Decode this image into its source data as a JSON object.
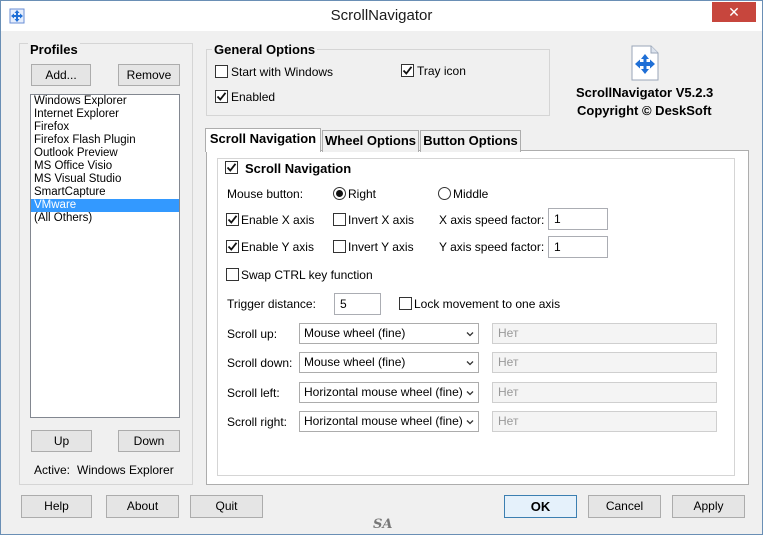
{
  "window": {
    "title": "ScrollNavigator",
    "close_glyph": "✕"
  },
  "profiles": {
    "heading": "Profiles",
    "add_label": "Add...",
    "remove_label": "Remove",
    "items": [
      "Windows Explorer",
      "Internet Explorer",
      "Firefox",
      "Firefox Flash Plugin",
      "Outlook Preview",
      "MS Office Visio",
      "MS Visual Studio",
      "SmartCapture",
      "VMware",
      "(All Others)"
    ],
    "selected_index": 8,
    "up_label": "Up",
    "down_label": "Down",
    "active_label": "Active:",
    "active_value": "Windows Explorer"
  },
  "general": {
    "heading": "General Options",
    "start_with_windows": {
      "label": "Start with Windows",
      "checked": false
    },
    "tray_icon": {
      "label": "Tray icon",
      "checked": true
    },
    "enabled": {
      "label": "Enabled",
      "checked": true
    }
  },
  "about": {
    "version": "ScrollNavigator V5.2.3",
    "copyright": "Copyright © DeskSoft"
  },
  "tabs": [
    "Scroll Navigation",
    "Wheel Options",
    "Button Options"
  ],
  "active_tab": 0,
  "scroll_nav": {
    "group_label": "Scroll Navigation",
    "group_checked": true,
    "mouse_button_label": "Mouse button:",
    "right_label": "Right",
    "middle_label": "Middle",
    "mouse_button_selected": "Right",
    "enable_x": {
      "label": "Enable X axis",
      "checked": true
    },
    "invert_x": {
      "label": "Invert X axis",
      "checked": false
    },
    "x_speed_label": "X axis speed factor:",
    "x_speed_value": "1",
    "enable_y": {
      "label": "Enable Y axis",
      "checked": true
    },
    "invert_y": {
      "label": "Invert Y axis",
      "checked": false
    },
    "y_speed_label": "Y axis speed factor:",
    "y_speed_value": "1",
    "swap_ctrl": {
      "label": "Swap CTRL key function",
      "checked": false
    },
    "trigger_label": "Trigger distance:",
    "trigger_value": "5",
    "lock_movement": {
      "label": "Lock movement to one axis",
      "checked": false
    },
    "rows": [
      {
        "label": "Scroll up:",
        "action": "Mouse wheel (fine)",
        "hotkey": "Нет"
      },
      {
        "label": "Scroll down:",
        "action": "Mouse wheel (fine)",
        "hotkey": "Нет"
      },
      {
        "label": "Scroll left:",
        "action": "Horizontal mouse wheel (fine)",
        "hotkey": "Нет"
      },
      {
        "label": "Scroll right:",
        "action": "Horizontal mouse wheel (fine)",
        "hotkey": "Нет"
      }
    ]
  },
  "footer": {
    "help": "Help",
    "about": "About",
    "quit": "Quit",
    "ok": "OK",
    "cancel": "Cancel",
    "apply": "Apply",
    "watermark": "SA"
  },
  "colors": {
    "accent": "#3399ff",
    "close": "#c7463d",
    "icon_blue": "#1f6fd6"
  }
}
